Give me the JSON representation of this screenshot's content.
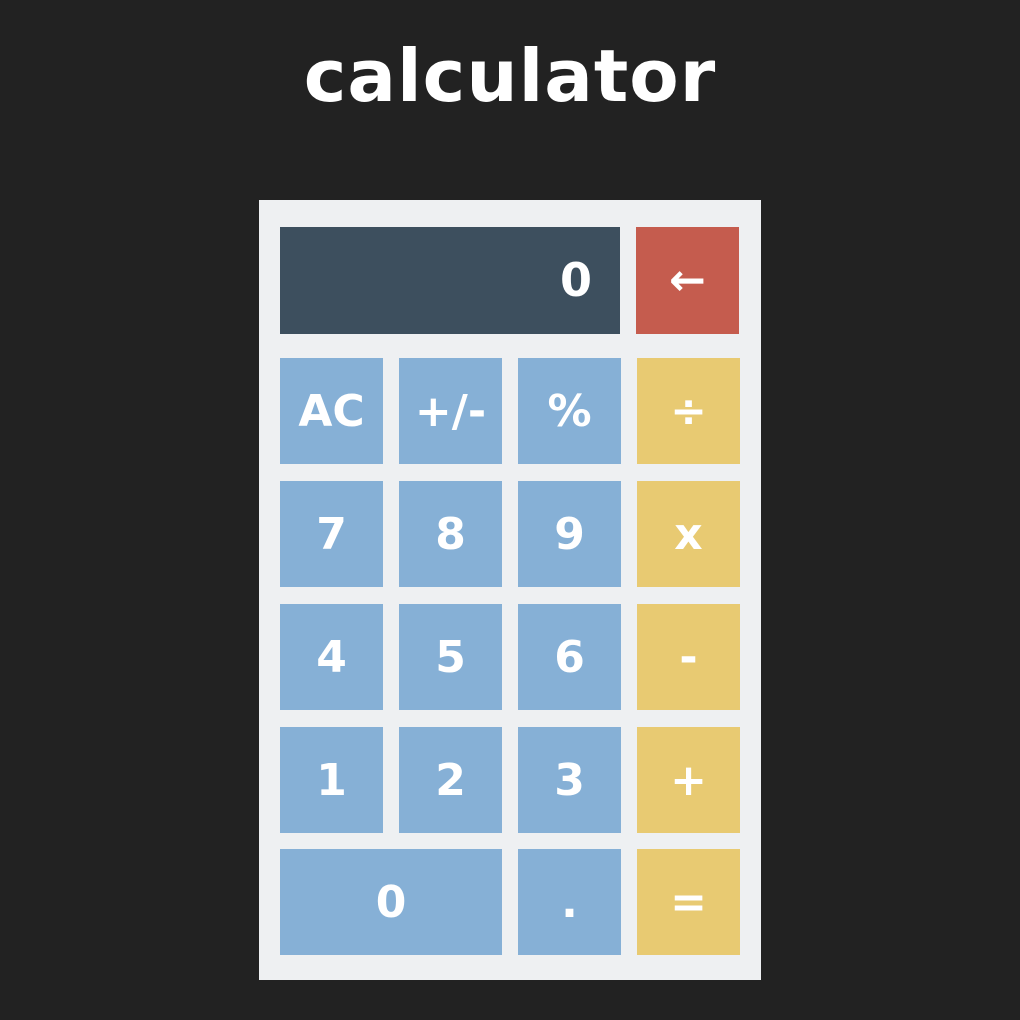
{
  "title": "calculator",
  "display": {
    "value": "0"
  },
  "keys": {
    "backspace": "←",
    "clear": "AC",
    "sign": "+/-",
    "percent": "%",
    "divide": "÷",
    "seven": "7",
    "eight": "8",
    "nine": "9",
    "multiply": "x",
    "four": "4",
    "five": "5",
    "six": "6",
    "subtract": "-",
    "one": "1",
    "two": "2",
    "three": "3",
    "add": "+",
    "zero": "0",
    "decimal": ".",
    "equals": "="
  },
  "colors": {
    "background": "#222222",
    "panel": "#eef0f2",
    "display": "#3d4f5e",
    "number_key": "#86b0d6",
    "operator_key": "#e8ca72",
    "backspace_key": "#c55c4e",
    "text": "#ffffff"
  }
}
